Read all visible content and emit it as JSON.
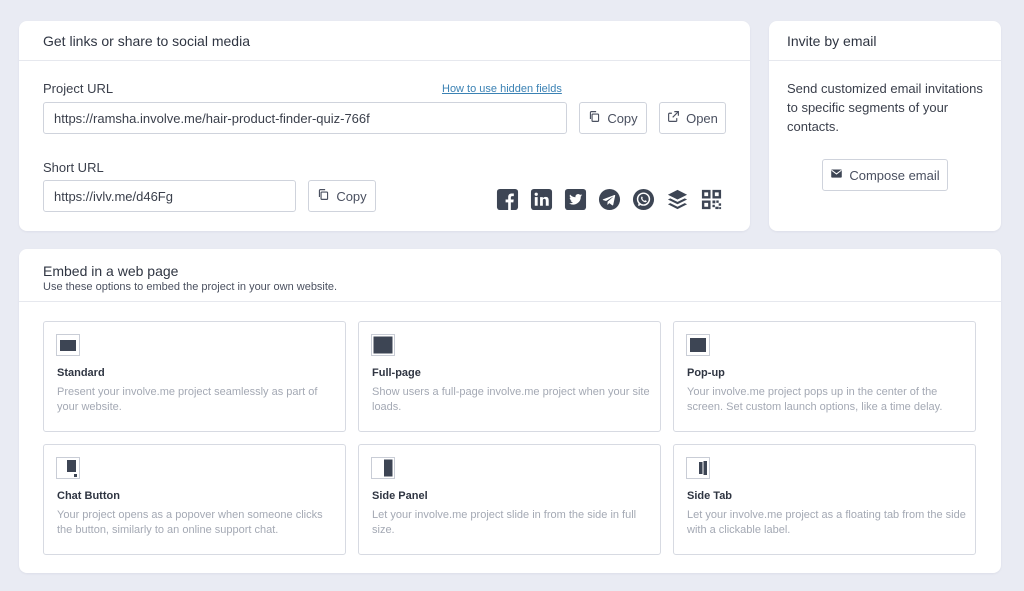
{
  "share": {
    "title": "Get links or share to social media",
    "project_url_label": "Project URL",
    "hidden_fields_link": "How to use hidden fields",
    "project_url_value": "https://ramsha.involve.me/hair-product-finder-quiz-766f",
    "copy_label": "Copy",
    "open_label": "Open",
    "short_url_label": "Short URL",
    "short_url_value": "https://ivlv.me/d46Fg",
    "short_copy_label": "Copy",
    "social_icons": [
      "facebook-icon",
      "linkedin-icon",
      "twitter-icon",
      "telegram-icon",
      "whatsapp-icon",
      "buffer-icon",
      "qr-code-icon"
    ]
  },
  "invite": {
    "title": "Invite by email",
    "description": "Send customized email invitations to specific segments of your contacts.",
    "compose_label": "Compose email"
  },
  "embed": {
    "title": "Embed in a web page",
    "subtitle": "Use these options to embed the project in your own website.",
    "options": [
      {
        "name": "Standard",
        "desc": "Present your involve.me project seamlessly as part of your website.",
        "icon": "standard-embed-icon"
      },
      {
        "name": "Full-page",
        "desc": "Show users a full-page involve.me project when your site loads.",
        "icon": "full-page-embed-icon"
      },
      {
        "name": "Pop-up",
        "desc": "Your involve.me project pops up in the center of the screen. Set custom launch options, like a time delay.",
        "icon": "popup-embed-icon"
      },
      {
        "name": "Chat Button",
        "desc": "Your project opens as a popover when someone clicks the button, similarly to an online support chat.",
        "icon": "chat-button-embed-icon"
      },
      {
        "name": "Side Panel",
        "desc": "Let your involve.me project slide in from the side in full size.",
        "icon": "side-panel-embed-icon"
      },
      {
        "name": "Side Tab",
        "desc": "Let your involve.me project as a floating tab from the side with a clickable label.",
        "icon": "side-tab-embed-icon"
      }
    ]
  },
  "colors": {
    "background": "#e9ebf3",
    "icon_dark": "#3d4554",
    "link": "#3b82b4"
  }
}
